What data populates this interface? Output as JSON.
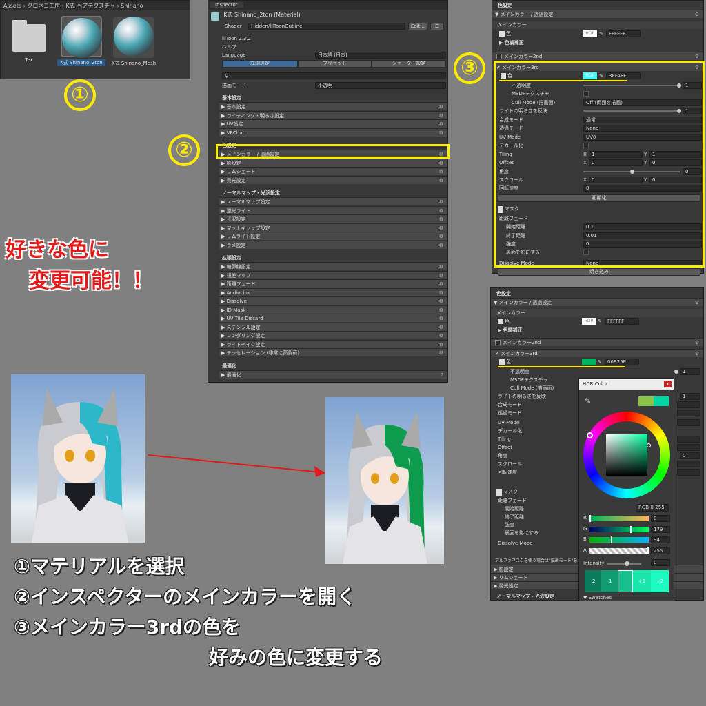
{
  "project": {
    "breadcrumbs": "Assets › クロネコ工房 › K式 ヘアテクスチャ › Shinano",
    "assets": [
      {
        "label": "Tex"
      },
      {
        "label": "K式 Shinano_2ton"
      },
      {
        "label": "K式 Shinano_Mesh"
      }
    ]
  },
  "inspector": {
    "tab": "Inspector",
    "material_name": "K式 Shinano_2ton (Material)",
    "shader_label": "Shader",
    "shader_value": "Hidden/lilToonOutline",
    "edit_button": "Edit...",
    "version": "lilToon 2.3.2",
    "help": "ヘルプ",
    "language_label": "Language",
    "language_value": "日本語 (日本)",
    "mode_tabs": [
      "詳細設定",
      "プリセット",
      "シェーダー設定"
    ],
    "render_mode_label": "描画モード",
    "render_mode_value": "不透明",
    "sections": [
      {
        "title": "基本設定",
        "items": [
          "基本設定",
          "ライティング・明るさ設定",
          "UV設定",
          "VRChat"
        ]
      },
      {
        "title": "色設定",
        "items": [
          "メインカラー / 透過設定",
          "影設定",
          "リムシェード",
          "発光設定"
        ]
      },
      {
        "title": "ノーマルマップ・光沢設定",
        "items": [
          "ノーマルマップ設定",
          "逆光ライト",
          "光沢設定",
          "マットキャップ設定",
          "リムライト設定",
          "ラメ設定"
        ]
      },
      {
        "title": "拡張設定",
        "items": [
          "輪郭線設定",
          "視差マップ",
          "距離フェード",
          "AudioLink",
          "Dissolve",
          "ID Mask",
          "UV Tile Discard",
          "ステンシル設定",
          "レンダリング設定",
          "ライトベイク設定",
          "テッセレーション (非常に高負荷)"
        ]
      },
      {
        "title": "最適化",
        "items": [
          "最適化"
        ]
      }
    ]
  },
  "panel_top": {
    "section": "色設定",
    "fold": "メインカラー / 透過設定",
    "main_color": "メインカラー",
    "color_label": "色",
    "hdr": "HDR",
    "main_hex": "FFFFFF",
    "tone_correction": "色調補正",
    "second": "メインカラー2nd",
    "third": "メインカラー3rd",
    "third_hex": "3EFAFF",
    "rows": [
      {
        "label": "不透明度",
        "value": "1"
      },
      {
        "label": "MSDFテクスチャ",
        "value": ""
      },
      {
        "label": "Cull Mode (描画面)",
        "value": "Off (両面を描画)"
      },
      {
        "label": "ライトの明るさを反映",
        "value": "1"
      },
      {
        "label": "合成モード",
        "value": "通常"
      },
      {
        "label": "透過モード",
        "value": "None"
      },
      {
        "label": "UV Mode",
        "value": "UV0"
      },
      {
        "label": "デカール化",
        "value": ""
      },
      {
        "label": "Tiling",
        "value": ""
      },
      {
        "label": "Offset",
        "value": ""
      },
      {
        "label": "角度",
        "value": "0"
      },
      {
        "label": "スクロール",
        "value": ""
      },
      {
        "label": "回転速度",
        "value": "0"
      }
    ],
    "tiling": {
      "x": "1",
      "y": "1"
    },
    "offset": {
      "x": "0",
      "y": "0"
    },
    "scroll": {
      "x": "0",
      "y": "0"
    },
    "axis_x": "X",
    "axis_y": "Y",
    "reset_button": "初期化",
    "mask": "マスク",
    "distance_fade": "距離フェード",
    "fade_rows": [
      {
        "label": "開始距離",
        "value": "0.1"
      },
      {
        "label": "終了距離",
        "value": "0.01"
      },
      {
        "label": "強度",
        "value": "0"
      },
      {
        "label": "裏面を影にする",
        "value": ""
      }
    ],
    "dissolve_label": "Dissolve Mode",
    "dissolve_value": "None",
    "bake_button": "焼き込み"
  },
  "panel_bottom": {
    "section": "色設定",
    "fold": "メインカラー / 透過設定",
    "main_color": "メインカラー",
    "color_label": "色",
    "hdr": "HDR",
    "main_hex": "FFFFFF",
    "tone_correction": "色調補正",
    "second": "メインカラー2nd",
    "third": "メインカラー3rd",
    "third_hex": "00B25E",
    "rows": [
      "不透明度",
      "MSDFテクスチャ",
      "Cull Mode (描画面)",
      "ライトの明るさを反映",
      "合成モード",
      "透過モード",
      "UV Mode",
      "デカール化",
      "Tiling",
      "Offset",
      "角度",
      "スクロール",
      "回転速度"
    ],
    "opacity_value": "1",
    "light_value": "1",
    "angle_value": "0",
    "mask": "マスク",
    "distance_fade": "距離フェード",
    "fade_rows": [
      "開始距離",
      "終了距離",
      "強度",
      "裏面を影にする"
    ],
    "dissolve_label": "Dissolve Mode",
    "alpha_note": "アルファマスクを使う場合は\"描画モード\"を",
    "bottom_items": [
      "影設定",
      "リムシェード",
      "発光設定"
    ],
    "normal_header": "ノーマルマップ・光沢設定"
  },
  "hdr_dialog": {
    "title": "HDR Color",
    "close": "x",
    "rgb_mode": "RGB 0-255",
    "channels": [
      {
        "label": "R",
        "value": "0",
        "level": 0
      },
      {
        "label": "G",
        "value": "179",
        "level": 0.7
      },
      {
        "label": "B",
        "value": "94",
        "level": 0.37
      },
      {
        "label": "A",
        "value": "255",
        "level": 1
      }
    ],
    "intensity_label": "Intensity",
    "intensity_value": "0",
    "presets": [
      "-2",
      "-1",
      "",
      "+1",
      "+2"
    ],
    "swatches": "Swatches"
  },
  "annotations": {
    "n1": "①",
    "n2": "②",
    "n3": "③",
    "red_line1": "好きな色に",
    "red_line2": "変更可能！！",
    "step1": "①マテリアルを選択",
    "step2": "②インスペクターのメインカラーを開く",
    "step3": "③メインカラー3rdの色を",
    "step3b": "好みの色に変更する"
  },
  "colors": {
    "yellow": "#ffeb00",
    "cyan_hair": "#3EFAFF",
    "green_hair": "#00B25E"
  }
}
